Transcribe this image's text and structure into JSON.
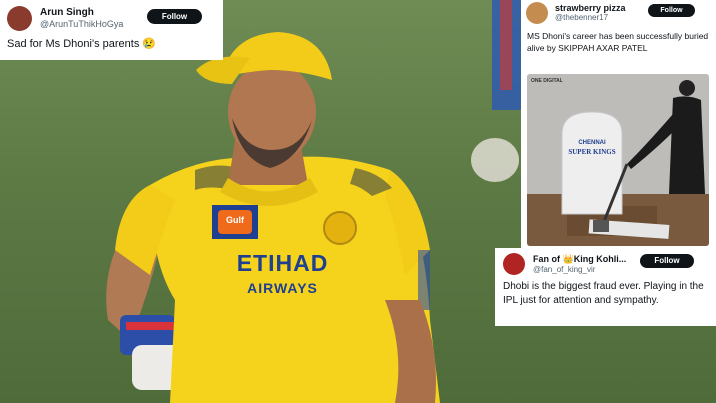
{
  "tweets": [
    {
      "name": "Arun Singh",
      "handle": "@ArunTuThikHoGya",
      "follow_label": "Follow",
      "text": "Sad for Ms Dhoni's parents 😢"
    },
    {
      "name": "strawberry pizza",
      "handle": "@thebenner17",
      "follow_label": "Follow",
      "text": "MS Dhoni's career has been successfully buried alive by SKIPPAH AXAR PATEL",
      "media": {
        "watermark": "ONE DIGITAL",
        "tombstone_line1": "CHENNAI",
        "tombstone_line2": "SUPER KINGS"
      }
    },
    {
      "name": "Fan of 👑King Kohli...",
      "handle": "@fan_of_king_vir",
      "follow_label": "Follow",
      "text": "Dhobi is the biggest fraud ever. Playing in the IPL just for attention and sympathy."
    }
  ],
  "jersey": {
    "sponsor_main": "ETIHAD",
    "sponsor_sub": "AIRWAYS",
    "badge": "Gulf"
  },
  "colors": {
    "follow_button": "#0f1419",
    "jersey_yellow": "#f5d21c",
    "field_green": "#5d7a45"
  }
}
